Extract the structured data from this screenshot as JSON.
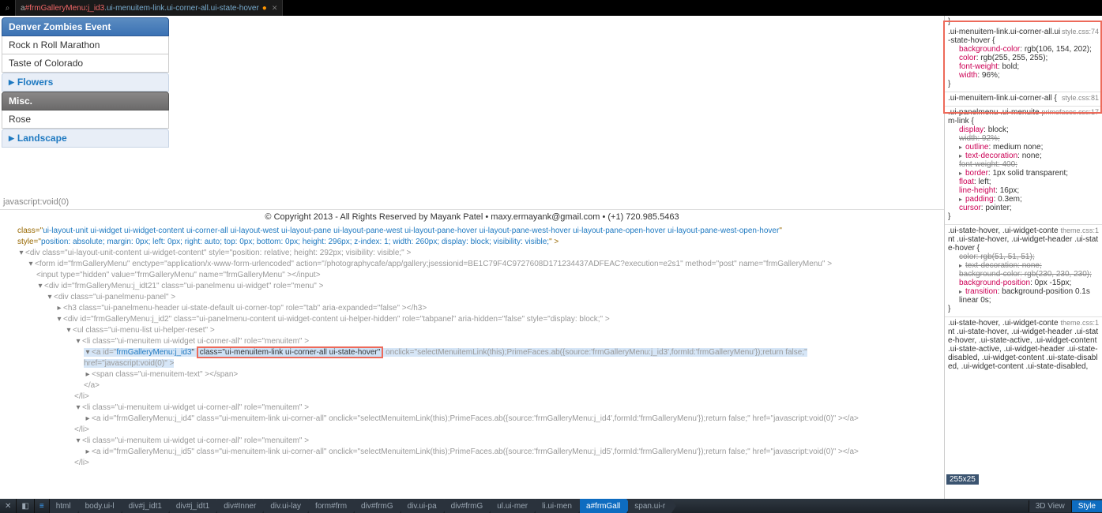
{
  "top_tab": {
    "prefix": "a",
    "hash": "#frmGalleryMenu:j_id3",
    "classes": ".ui-menuitem-link.ui-corner-all.ui-state-hover",
    "bullet": "●"
  },
  "preview": {
    "headers": {
      "h1": "Denver Zombies Event",
      "item1": "Rock n Roll Marathon",
      "item2": "Taste of Colorado",
      "h2": "Flowers",
      "h3": "Misc.",
      "item3": "Rose",
      "h4": "Landscape"
    },
    "statusbar": "javascript:void(0)",
    "copyright": "© Copyright 2013 - All Rights Reserved by Mayank Patel • maxy.ermayank@gmail.com • (+1) 720.985.5463"
  },
  "dom": {
    "n0_a": "class=\"",
    "n0_b": "ui-layout-unit ui-widget ui-widget-content ui-corner-all ui-layout-west ui-layout-pane ui-layout-pane-west ui-layout-pane-hover ui-layout-pane-west-hover ui-layout-pane-open-hover ui-layout-pane-west-open-hover",
    "n0_c": "\"",
    "n0_d": "style=\"",
    "n0_e": "position: absolute; margin: 0px; left: 0px; right: auto; top: 0px; bottom: 0px; height: 296px; z-index: 1; width: 260px; display: block; visibility: visible;",
    "n0_f": "\" >",
    "n1": "<div class=\"ui-layout-unit-content ui-widget-content\" style=\"position: relative; height: 292px; visibility: visible;\" >",
    "n2": "<form id=\"frmGalleryMenu\" enctype=\"application/x-www-form-urlencoded\" action=\"/photographycafe/app/gallery;jsessionid=BE1C79F4C9727608D171234437ADFEAC?execution=e2s1\" method=\"post\" name=\"frmGalleryMenu\" >",
    "n3": "<input type=\"hidden\" value=\"frmGalleryMenu\" name=\"frmGalleryMenu\" ></input>",
    "n4": "<div id=\"frmGalleryMenu:j_idt21\" class=\"ui-panelmenu ui-widget\" role=\"menu\" >",
    "n5": "<div class=\"ui-panelmenu-panel\" >",
    "n6": "<h3 class=\"ui-panelmenu-header ui-state-default ui-corner-top\" role=\"tab\" aria-expanded=\"false\" ></h3>",
    "n7": "<div id=\"frmGalleryMenu:j_id2\" class=\"ui-panelmenu-content ui-widget-content ui-helper-hidden\" role=\"tabpanel\" aria-hidden=\"false\" style=\"display: block;\" >",
    "n8": "<ul class=\"ui-menu-list ui-helper-reset\" >",
    "n9": "<li class=\"ui-menuitem ui-widget ui-corner-all\" role=\"menuitem\" >",
    "n10_a": "<a id=\"",
    "n10_b": "frmGalleryMenu:j_id3",
    "n10_c": "class=\"ui-menuitem-link ui-corner-all ui-state-hover\"",
    "n10_d": "onclick=\"selectMenuitemLink(this);PrimeFaces.ab({source:'frmGalleryMenu:j_id3',formId:'frmGalleryMenu'});return false;\"",
    "n10_e": "href=\"javascript:void(0)\" >",
    "n11": "<span class=\"ui-menuitem-text\" ></span>",
    "n12": "</a>",
    "n13": "</li>",
    "n14": "<li class=\"ui-menuitem ui-widget ui-corner-all\" role=\"menuitem\" >",
    "n15": "<a id=\"frmGalleryMenu:j_id4\" class=\"ui-menuitem-link ui-corner-all\" onclick=\"selectMenuitemLink(this);PrimeFaces.ab({source:'frmGalleryMenu:j_id4',formId:'frmGalleryMenu'});return false;\" href=\"javascript:void(0)\" ></a>",
    "n16": "</li>",
    "n17": "<li class=\"ui-menuitem ui-widget ui-corner-all\" role=\"menuitem\" >",
    "n18": "<a id=\"frmGalleryMenu:j_id5\" class=\"ui-menuitem-link ui-corner-all\" onclick=\"selectMenuitemLink(this);PrimeFaces.ab({source:'frmGalleryMenu:j_id5',formId:'frmGalleryMenu'});return false;\" href=\"javascript:void(0)\" ></a>",
    "n19": "</li>"
  },
  "styles": {
    "brace_close_top": "}",
    "r1": {
      "src": "style.css:74",
      "selector": ".ui-menuitem-link.ui-corner-all.ui-state-hover {",
      "p1n": "background-color",
      "p1v": ": rgb(106, 154, 202);",
      "p2n": "color",
      "p2v": ": rgb(255, 255, 255);",
      "p3n": "font-weight",
      "p3v": ": bold;",
      "p4n": "width",
      "p4v": ": 96%;",
      "end": "}"
    },
    "r2": {
      "src": "style.css:81",
      "selector": ".ui-menuitem-link.ui-corner-all {"
    },
    "r3": {
      "src": "primefaces.css:17",
      "selector": ".ui-panelmenu .ui-menuitem-link {",
      "p1n": "display",
      "p1v": ": block;",
      "p2": "width: 92%;",
      "p3n": "outline",
      "p3v": ": medium none;",
      "p4n": "text-decoration",
      "p4v": ": none;",
      "p5": "font-weight: 400;",
      "p6n": "border",
      "p6v": ": 1px solid transparent;",
      "p7n": "float",
      "p7v": ": left;",
      "p8n": "line-height",
      "p8v": ": 16px;",
      "p9n": "padding",
      "p9v": ": 0.3em;",
      "p10n": "cursor",
      "p10v": ": pointer;",
      "end": "}"
    },
    "r4": {
      "src": "theme.css:1",
      "selector": ".ui-state-hover, .ui-widget-content .ui-state-hover, .ui-widget-header .ui-state-hover {",
      "p1": "color: rgb(51, 51, 51);",
      "p2": "text-decoration: none;",
      "p3": "background-color: rgb(230, 230, 230);",
      "p4n": "background-position",
      "p4v": ": 0px -15px;",
      "p5n": "transition",
      "p5v": ": background-position 0.1s linear 0s;",
      "end": "}"
    },
    "r5": {
      "src": "theme.css:1",
      "selector": ".ui-state-hover, .ui-widget-content .ui-state-hover, .ui-widget-header .ui-state-hover, .ui-state-active, .ui-widget-content .ui-state-active, .ui-widget-header .ui-state-disabled, .ui-widget-content .ui-state-disabled, .ui-widget-content .ui-state-disabled,"
    },
    "dim": "255x25"
  },
  "bottom": {
    "x": "✕",
    "sq": "◧",
    "lines": "≡",
    "c0": "html",
    "c1": "body.ui-l",
    "c2": "div#j_idt1",
    "c3": "div#j_idt1",
    "c4": "div#Inner",
    "c5": "div.ui-lay",
    "c6": "form#frm",
    "c7": "div#frmG",
    "c8": "div.ui-pa",
    "c9": "div#frmG",
    "c10": "ul.ui-mer",
    "c11": "li.ui-men",
    "c12": "a#frmGall",
    "c13": "span.ui-r",
    "r1": "3D View",
    "r2": "Style"
  }
}
